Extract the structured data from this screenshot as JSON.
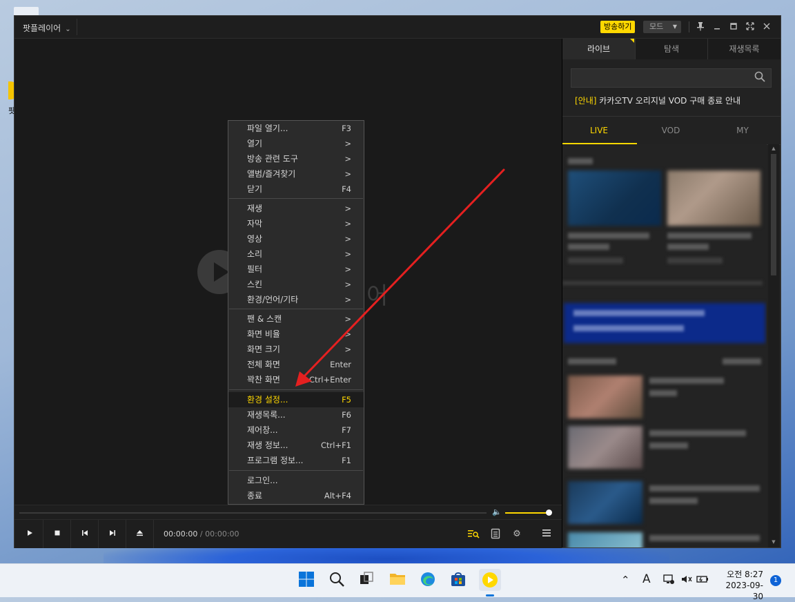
{
  "window": {
    "title": "팟플레이어",
    "broadcast_label": "방송하기",
    "mode_label": "모드"
  },
  "player": {
    "time_current": "00:00:00",
    "time_separator": "/",
    "time_duration": "00:00:00",
    "volume": 0.9
  },
  "context_menu": {
    "groups": [
      [
        {
          "label": "파일 열기...",
          "shortcut": "F3"
        },
        {
          "label": "열기",
          "shortcut": ">"
        },
        {
          "label": "방송 관련 도구",
          "shortcut": ">"
        },
        {
          "label": "앨범/즐겨찾기",
          "shortcut": ">"
        },
        {
          "label": "닫기",
          "shortcut": "F4"
        }
      ],
      [
        {
          "label": "재생",
          "shortcut": ">"
        },
        {
          "label": "자막",
          "shortcut": ">"
        },
        {
          "label": "영상",
          "shortcut": ">"
        },
        {
          "label": "소리",
          "shortcut": ">"
        },
        {
          "label": "필터",
          "shortcut": ">"
        },
        {
          "label": "스킨",
          "shortcut": ">"
        },
        {
          "label": "환경/언어/기타",
          "shortcut": ">"
        }
      ],
      [
        {
          "label": "팬 & 스캔",
          "shortcut": ">"
        },
        {
          "label": "화면 비율",
          "shortcut": ">"
        },
        {
          "label": "화면 크기",
          "shortcut": ">"
        },
        {
          "label": "전체 화면",
          "shortcut": "Enter"
        },
        {
          "label": "꽉찬 화면",
          "shortcut": "Ctrl+Enter"
        }
      ],
      [
        {
          "label": "환경 설정...",
          "shortcut": "F5",
          "highlighted": true
        },
        {
          "label": "재생목록...",
          "shortcut": "F6"
        },
        {
          "label": "제어창...",
          "shortcut": "F7"
        },
        {
          "label": "재생 정보...",
          "shortcut": "Ctrl+F1"
        },
        {
          "label": "프로그램 정보...",
          "shortcut": "F1"
        }
      ],
      [
        {
          "label": "로그인...",
          "shortcut": ""
        },
        {
          "label": "종료",
          "shortcut": "Alt+F4"
        }
      ]
    ]
  },
  "panel": {
    "tabs": [
      "라이브",
      "탐색",
      "재생목록"
    ],
    "active_tab": 0,
    "search_placeholder": "",
    "notice_tag": "[안내]",
    "notice_text": " 카카오TV 오리지널 VOD 구매 종료 안내",
    "subtabs": [
      "LIVE",
      "VOD",
      "MY"
    ],
    "active_subtab": 0
  },
  "taskbar": {
    "clock_period": "오전 8:27",
    "clock_date": "2023-09-30",
    "notification_count": "1",
    "ime_label": "A"
  },
  "desktop": {
    "icon_label": "팟"
  },
  "colors": {
    "accent": "#ffd800",
    "arrow": "#e52020",
    "menu_bg": "#2b2b2b",
    "highlight_bg": "#1c1c1c"
  }
}
